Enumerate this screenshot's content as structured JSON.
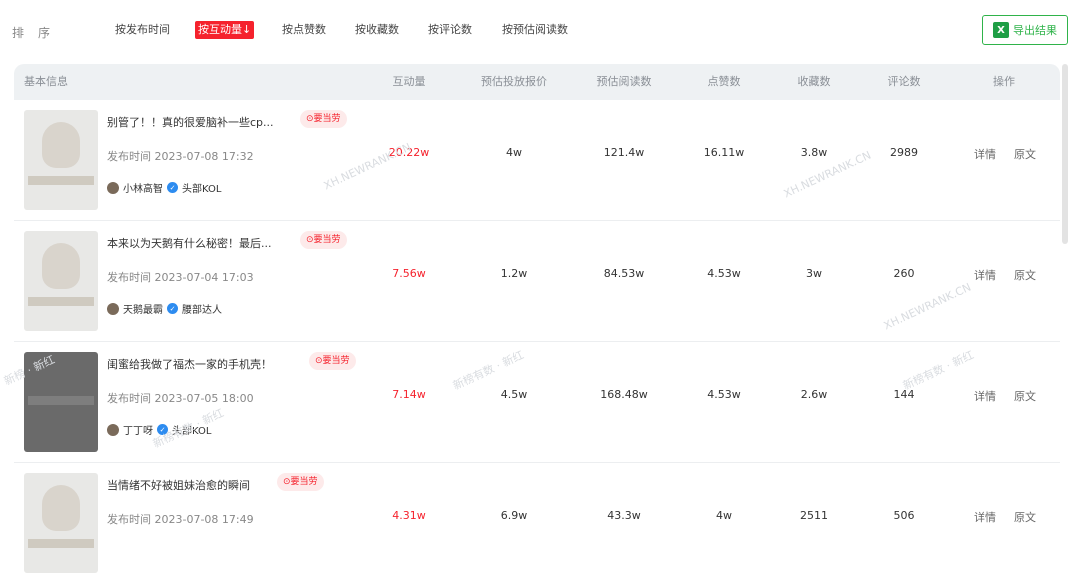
{
  "sort": {
    "label": "排序",
    "options": [
      "按发布时间",
      "按互动量↓",
      "按点赞数",
      "按收藏数",
      "按评论数",
      "按预估阅读数"
    ],
    "active_index": 1
  },
  "export": {
    "icon": "excel-icon",
    "icon_text": "X",
    "label": "导出结果"
  },
  "table": {
    "headers": [
      "基本信息",
      "互动量",
      "预估投放报价",
      "预估阅读数",
      "点赞数",
      "收藏数",
      "评论数",
      "操作"
    ],
    "rows": [
      {
        "title": "别管了！！真的很爱脑补一些cp...",
        "tag": "⊙要当劳",
        "pubtime": "发布时间 2023-07-08 17:32",
        "author": "小林高智",
        "badge": "头部KOL",
        "interaction": "20.22w",
        "price": "4w",
        "reads": "121.4w",
        "likes": "16.11w",
        "favorites": "3.8w",
        "comments": "2989",
        "detail": "详情",
        "original": "原文"
      },
      {
        "title": "本来以为天鹅有什么秘密！最后...",
        "tag": "⊙要当劳",
        "pubtime": "发布时间 2023-07-04 17:03",
        "author": "天鹅最霸",
        "badge": "腰部达人",
        "interaction": "7.56w",
        "price": "1.2w",
        "reads": "84.53w",
        "likes": "4.53w",
        "favorites": "3w",
        "comments": "260",
        "detail": "详情",
        "original": "原文"
      },
      {
        "title": "闺蜜给我做了福杰一家的手机壳！",
        "tag": "⊙要当劳",
        "pubtime": "发布时间 2023-07-05 18:00",
        "author": "丁丁呀",
        "badge": "头部KOL",
        "interaction": "7.14w",
        "price": "4.5w",
        "reads": "168.48w",
        "likes": "4.53w",
        "favorites": "2.6w",
        "comments": "144",
        "detail": "详情",
        "original": "原文"
      },
      {
        "title": "当情绪不好被姐妹治愈的瞬间",
        "tag": "⊙要当劳",
        "pubtime": "发布时间 2023-07-08 17:49",
        "author": "",
        "badge": "",
        "interaction": "4.31w",
        "price": "6.9w",
        "reads": "43.3w",
        "likes": "4w",
        "favorites": "2511",
        "comments": "506",
        "detail": "详情",
        "original": "原文"
      }
    ]
  },
  "watermarks": [
    "XH.NEWRANK.CN",
    "XH.NEWRANK.CN",
    "XH.NEWRANK.CN",
    "新榜有数 · 新红",
    "新榜有数 · 新红",
    "新榜有数 · 新红",
    "新榜 · 新红"
  ]
}
